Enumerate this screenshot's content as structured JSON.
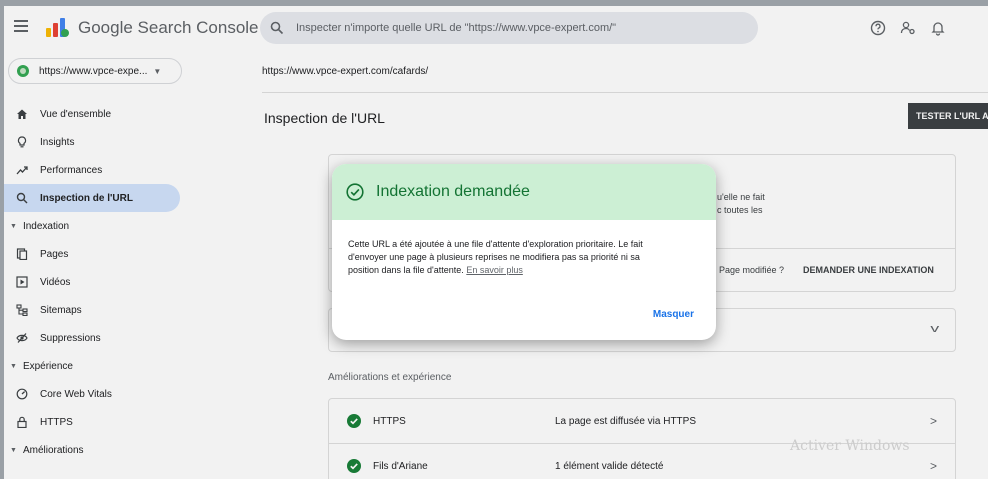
{
  "header": {
    "app_title": "Google Search Console",
    "search_placeholder": "Inspecter n'importe quelle URL de \"https://www.vpce-expert.com/\"",
    "icons": [
      "menu-icon",
      "search-console-logo-icon",
      "search-icon",
      "help-icon",
      "manage-users-icon",
      "notifications-icon"
    ]
  },
  "sidebar": {
    "property": "https://www.vpce-expe...",
    "items": [
      {
        "label": "Vue d'ensemble",
        "icon": "home-icon"
      },
      {
        "label": "Insights",
        "icon": "lightbulb-icon"
      },
      {
        "label": "Performances",
        "icon": "trending-icon"
      },
      {
        "label": "Inspection de l'URL",
        "icon": "search-icon",
        "active": true
      }
    ],
    "section_indexation": "Indexation",
    "indexation_items": [
      {
        "label": "Pages",
        "icon": "pages-icon"
      },
      {
        "label": "Vidéos",
        "icon": "video-icon"
      },
      {
        "label": "Sitemaps",
        "icon": "sitemap-icon"
      },
      {
        "label": "Suppressions",
        "icon": "removals-icon"
      }
    ],
    "section_experience": "Expérience",
    "experience_items": [
      {
        "label": "Core Web Vitals",
        "icon": "gauge-icon"
      },
      {
        "label": "HTTPS",
        "icon": "lock-icon"
      }
    ],
    "section_ameliorations": "Améliorations"
  },
  "main": {
    "url": "https://www.vpce-expert.com/cafards/",
    "title": "Inspection de l'URL",
    "test_button": "TESTER L'URL A",
    "fragment_line1": "u'elle ne fait",
    "fragment_line2": "c toutes les",
    "page_modified": "Page modifiée ?",
    "request_indexing": "DEMANDER UNE INDEXATION",
    "enhancements_label": "Améliorations et expérience",
    "rows": [
      {
        "name": "HTTPS",
        "desc": "La page est diffusée via HTTPS"
      },
      {
        "name": "Fils d'Ariane",
        "desc": "1 élément valide détecté"
      }
    ],
    "watermark": "Activer Windows"
  },
  "dialog": {
    "title": "Indexation demandée",
    "body_line1": "Cette URL a été ajoutée à une file d'attente d'exploration prioritaire. Le fait",
    "body_line2": "d'envoyer une page à plusieurs reprises ne modifiera pas sa priorité ni sa",
    "body_line3": "position dans la file d'attente.",
    "learn_more": "En savoir plus",
    "dismiss": "Masquer"
  },
  "colors": {
    "dialog_header_bg": "#ccefd4",
    "success_green": "#137333",
    "active_nav_bg": "#d2e3fc",
    "link_blue": "#1a73e8",
    "check_green": "#188038"
  }
}
